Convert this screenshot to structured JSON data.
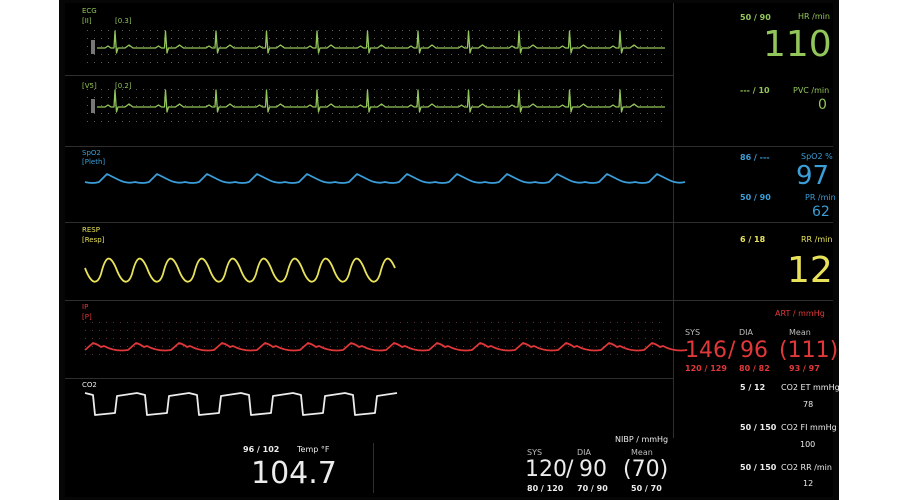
{
  "channels": {
    "ecg": {
      "label": "ECG",
      "lead": "[II]",
      "gain": "[0.3]"
    },
    "ecg2": {
      "lead": "[V5]",
      "gain": "[0.2]"
    },
    "spo2": {
      "label": "SpO2",
      "source": "[Pleth]"
    },
    "resp": {
      "label": "RESP",
      "source": "[Resp]"
    },
    "ip": {
      "label": "IP",
      "source": "[P]"
    },
    "co2": {
      "label": "CO2"
    }
  },
  "params": {
    "hr": {
      "alarm": "50 ∕ 90",
      "unit": "HR /min",
      "value": "110"
    },
    "pvc": {
      "alarm": "--- ∕ 10",
      "unit": "PVC /min",
      "value": "0"
    },
    "spo2": {
      "alarm": "86 ∕ ---",
      "unit": "SpO2 %",
      "value": "97"
    },
    "pr": {
      "alarm": "50 ∕ 90",
      "unit": "PR /min",
      "value": "62"
    },
    "rr": {
      "alarm": "6 ∕ 18",
      "unit": "RR /min",
      "value": "12"
    },
    "art": {
      "title": "ART / mmHg",
      "sys_label": "SYS",
      "dia_label": "DIA",
      "mean_label": "Mean",
      "sys": "146",
      "slash": "/",
      "dia": "96",
      "mean": "(111)",
      "sys_alarm": "120 ∕ 129",
      "dia_alarm": "80 ∕ 82",
      "mean_alarm": "93 ∕ 97"
    },
    "co2_et": {
      "alarm": "5 ∕ 12",
      "unit": "CO2 ET mmHg",
      "value": "78"
    },
    "co2_fi": {
      "alarm": "50 ∕ 150",
      "unit": "CO2 FI mmHg",
      "value": "100"
    },
    "co2_rr": {
      "alarm": "50 ∕ 150",
      "unit": "CO2 RR /min",
      "value": "12"
    },
    "temp": {
      "alarm": "96 ∕ 102",
      "unit": "Temp °F",
      "value": "104.7"
    },
    "nibp": {
      "title": "NIBP / mmHg",
      "sys_label": "SYS",
      "dia_label": "DIA",
      "mean_label": "Mean",
      "sys": "120",
      "slash": "/",
      "dia": "90",
      "mean": "(70)",
      "sys_alarm": "80 ∕ 120",
      "dia_alarm": "70 ∕ 90",
      "mean_alarm": "50 ∕ 70"
    }
  },
  "colors": {
    "ecg": "#93c65a",
    "spo2": "#3b9ed8",
    "resp": "#e8e25a",
    "ip": "#e0383a",
    "co2": "#ececec",
    "divider": "#2e2e2e"
  }
}
